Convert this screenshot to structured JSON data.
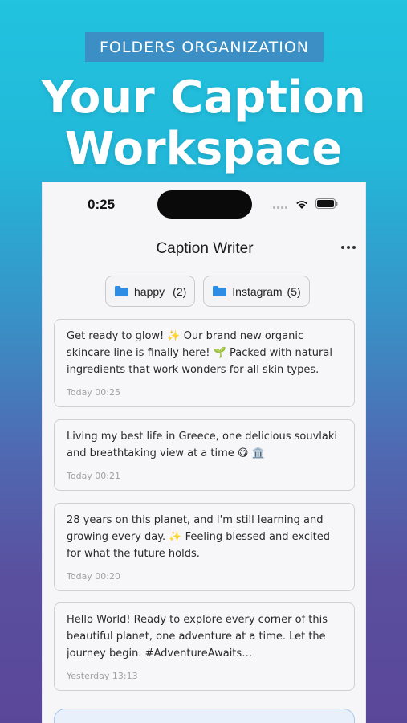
{
  "promo": {
    "badge": "FOLDERS ORGANIZATION",
    "title_line1": "Your Caption",
    "title_line2": "Workspace"
  },
  "status_bar": {
    "time": "0:25",
    "icons": [
      "signal-dots-icon",
      "wifi-icon",
      "battery-icon"
    ]
  },
  "header": {
    "title": "Caption Writer",
    "menu_icon": "more-horizontal-icon"
  },
  "folders": [
    {
      "name": "happy",
      "count": "(2)",
      "icon": "folder-icon"
    },
    {
      "name": "Instagram",
      "count": "(5)",
      "icon": "folder-icon"
    }
  ],
  "captions": [
    {
      "text": "Get ready to glow! ✨ Our brand new organic skincare line is finally here! 🌱 Packed with natural ingredients that work wonders for all skin types.",
      "date": "Today 00:25"
    },
    {
      "text": "Living my best life in Greece, one delicious souvlaki and breathtaking view at a time 😋 🏛️",
      "date": "Today 00:21"
    },
    {
      "text": "28 years on this planet, and I'm still learning and growing every day. ✨ Feeling blessed and excited for what the future holds.",
      "date": "Today 00:20"
    },
    {
      "text": "Hello World! Ready to explore every corner of this beautiful planet, one adventure at a time. Let the journey begin. #AdventureAwaits #ExploreTheWorld",
      "date": "Yesterday 13:13"
    }
  ],
  "colors": {
    "folder_blue": "#2f8de4",
    "background_top": "#21c3df",
    "background_bottom": "#5b479a",
    "new_button_bg": "#e8f0fb"
  }
}
